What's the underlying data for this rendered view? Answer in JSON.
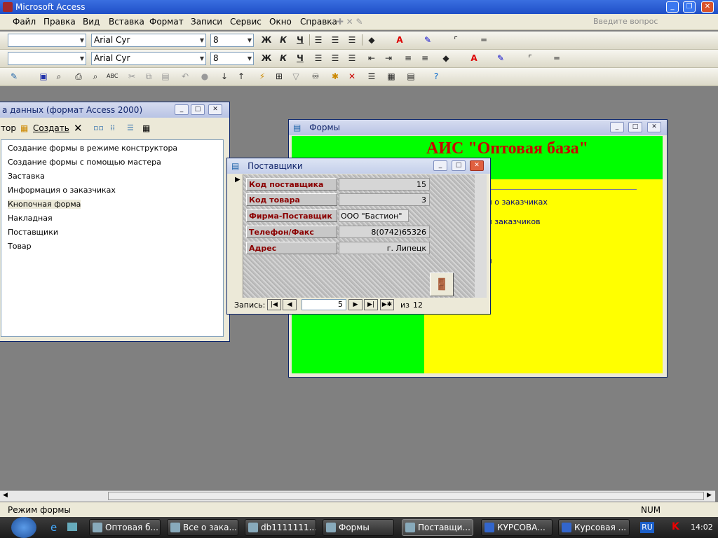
{
  "window": {
    "title": "Microsoft Access"
  },
  "menu": [
    "Файл",
    "Правка",
    "Вид",
    "Вставка",
    "Формат",
    "Записи",
    "Сервис",
    "Окно",
    "Справка"
  ],
  "help_placeholder": "Введите вопрос",
  "toolbar1": {
    "style_combo": "",
    "font": "Arial Cyr",
    "size": "8",
    "bold": "Ж",
    "italic": "К",
    "underline": "Ч"
  },
  "toolbar2": {
    "style_combo": "",
    "font": "Arial Cyr",
    "size": "8",
    "bold": "Ж",
    "italic": "К",
    "underline": "Ч"
  },
  "db_window": {
    "title": "а данных (формат Access 2000)",
    "toolbar": {
      "designer": "тор",
      "create": "Создать"
    },
    "items": [
      "Создание формы в режиме конструктора",
      "Создание формы с помощью мастера",
      "Заставка",
      "Информация о заказчиках",
      "Кнопочная форма",
      "Накладная",
      "Поставщики",
      "Товар"
    ],
    "selected": "Кнопочная форма"
  },
  "forms_window": {
    "title": "Формы",
    "heading": "АИС \"Оптовая база\"",
    "items": [
      "ия о заказчиках",
      "ия заказчиков",
      "ки"
    ],
    "colors": {
      "green": "#00ff00",
      "yellow": "#ffff00",
      "heading": "#cc0000"
    }
  },
  "suppliers_window": {
    "title": "Поставщики",
    "fields": [
      {
        "label": "Код поставщика",
        "value": "15"
      },
      {
        "label": "Код товара",
        "value": "3"
      },
      {
        "label": "Фирма-Поставщик",
        "value": "ООО \"Бастион\""
      },
      {
        "label": "Телефон/Факс",
        "value": "8(0742)65326"
      },
      {
        "label": "Адрес",
        "value": "г. Липецк"
      }
    ],
    "nav": {
      "label": "Запись:",
      "current": "5",
      "of_label": "из",
      "total": "12"
    }
  },
  "statusbar": {
    "mode": "Режим формы",
    "num": "NUM"
  },
  "taskbar": {
    "tasks": [
      "Оптовая б...",
      "Все о зака...",
      "db1111111...",
      "Формы",
      "Поставщи...",
      "КУРСОВА...",
      "Курсовая ..."
    ],
    "lang": "RU",
    "clock": "14:02"
  }
}
